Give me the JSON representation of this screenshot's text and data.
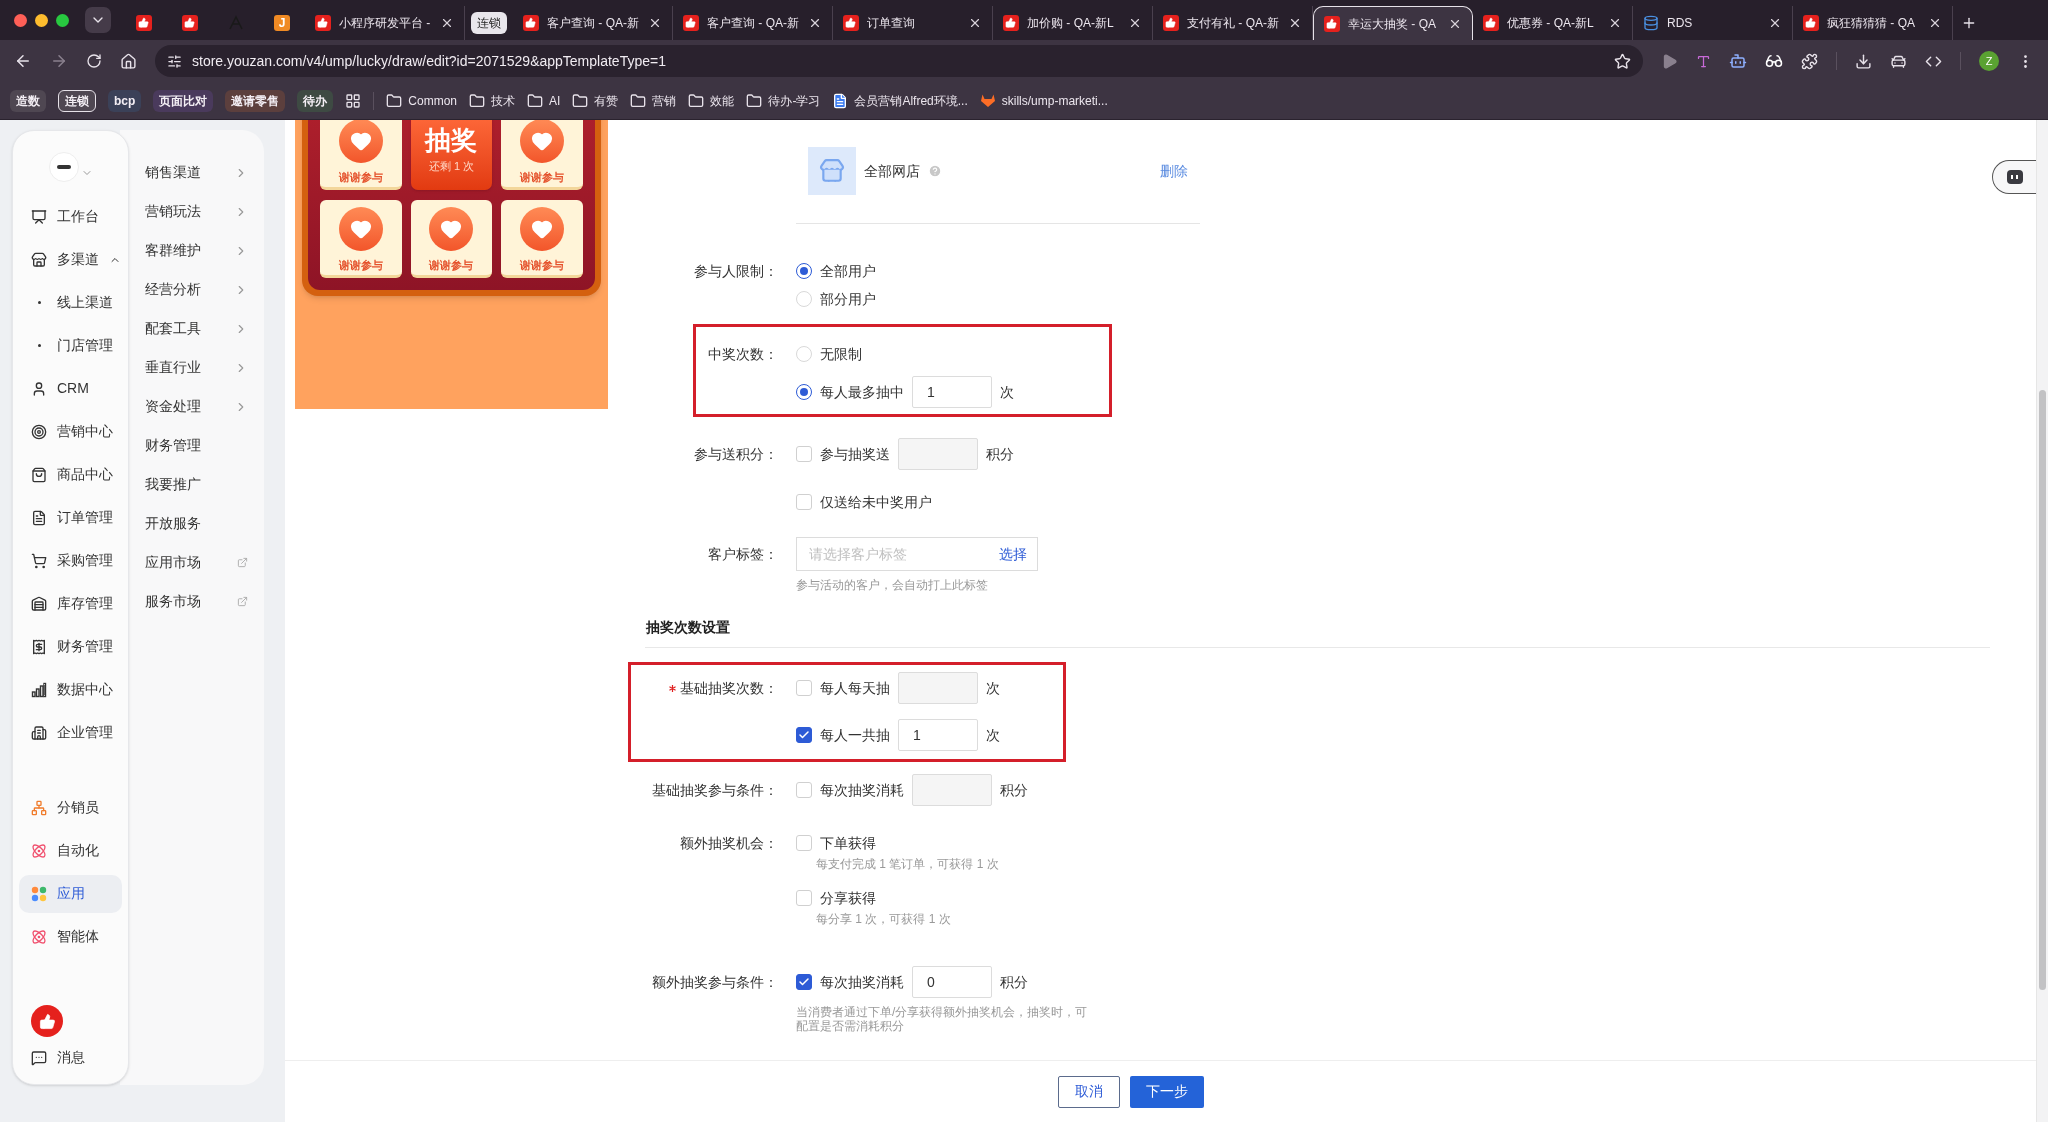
{
  "browser": {
    "tabs": [
      {
        "kind": "pinned",
        "selected": false
      },
      {
        "kind": "pinned",
        "selected": false
      },
      {
        "kind": "pinned",
        "selected": false
      },
      {
        "kind": "pinned",
        "glyph": "J",
        "selected": false
      },
      {
        "kind": "page",
        "label": "小程序研发平台 -",
        "selected": false
      },
      {
        "kind": "group",
        "label": "连锁",
        "selected": false
      },
      {
        "kind": "page",
        "label": "客户查询 - QA-新",
        "selected": false
      },
      {
        "kind": "page",
        "label": "客户查询 - QA-新",
        "selected": false
      },
      {
        "kind": "page",
        "label": "订单查询",
        "selected": false
      },
      {
        "kind": "page",
        "label": "加价购 - QA-新L",
        "selected": false
      },
      {
        "kind": "page",
        "label": "支付有礼 - QA-新",
        "selected": false
      },
      {
        "kind": "page",
        "label": "幸运大抽奖 - QA",
        "selected": true
      },
      {
        "kind": "page",
        "label": "优惠券 - QA-新L",
        "selected": false
      },
      {
        "kind": "page",
        "label": "RDS",
        "selected": false
      },
      {
        "kind": "page",
        "label": "疯狂猜猜猜 - QA",
        "selected": false
      }
    ],
    "address": "store.youzan.com/v4/ump/lucky/draw/edit?id=2071529&appTemplateType=1",
    "profile_initial": "Z",
    "bookmarks": [
      {
        "kind": "chip",
        "label": "造数",
        "color": "#4f4752",
        "outlined": false
      },
      {
        "kind": "chip",
        "label": "连锁",
        "color": "#4f4752",
        "outlined": true
      },
      {
        "kind": "chip",
        "label": "bcp",
        "color": "#3b4158",
        "outlined": false
      },
      {
        "kind": "chip",
        "label": "页面比对",
        "color": "#4a3a5c",
        "outlined": false
      },
      {
        "kind": "chip",
        "label": "邀请零售",
        "color": "#5c3f3d",
        "outlined": false
      },
      {
        "kind": "chip",
        "label": "待办",
        "color": "#3e4a43",
        "outlined": false
      },
      {
        "kind": "apps"
      },
      {
        "kind": "folder",
        "label": "Common"
      },
      {
        "kind": "folder",
        "label": "技术"
      },
      {
        "kind": "folder",
        "label": "AI"
      },
      {
        "kind": "folder",
        "label": "有赞"
      },
      {
        "kind": "folder",
        "label": "营销"
      },
      {
        "kind": "folder",
        "label": "效能"
      },
      {
        "kind": "folder",
        "label": "待办-学习"
      },
      {
        "kind": "doc",
        "label": "会员营销Alfred环境..."
      },
      {
        "kind": "gitlab",
        "label": "skills/ump-marketi..."
      }
    ]
  },
  "nav": {
    "main": [
      {
        "label": "工作台",
        "selected": false
      },
      {
        "label": "多渠道",
        "selected": false,
        "expanded": true,
        "children": [
          {
            "label": "线上渠道",
            "selected": false
          },
          {
            "label": "门店管理",
            "selected": false
          }
        ]
      },
      {
        "label": "CRM",
        "selected": false
      },
      {
        "label": "营销中心",
        "selected": false
      },
      {
        "label": "商品中心",
        "selected": false
      },
      {
        "label": "订单管理",
        "selected": false
      },
      {
        "label": "采购管理",
        "selected": false
      },
      {
        "label": "库存管理",
        "selected": false
      },
      {
        "label": "财务管理",
        "selected": false
      },
      {
        "label": "数据中心",
        "selected": false
      },
      {
        "label": "企业管理",
        "selected": false
      }
    ],
    "apps": [
      {
        "label": "分销员",
        "selected": false
      },
      {
        "label": "自动化",
        "selected": false
      },
      {
        "label": "应用",
        "selected": true
      },
      {
        "label": "智能体",
        "selected": false
      }
    ],
    "message": "消息"
  },
  "submenu": [
    {
      "label": "销售渠道",
      "kind": "submenu"
    },
    {
      "label": "营销玩法",
      "kind": "submenu"
    },
    {
      "label": "客群维护",
      "kind": "submenu"
    },
    {
      "label": "经营分析",
      "kind": "submenu"
    },
    {
      "label": "配套工具",
      "kind": "submenu"
    },
    {
      "label": "垂直行业",
      "kind": "submenu"
    },
    {
      "label": "资金处理",
      "kind": "submenu"
    },
    {
      "label": "财务管理",
      "kind": "plain"
    },
    {
      "label": "我要推广",
      "kind": "plain"
    },
    {
      "label": "开放服务",
      "kind": "plain"
    },
    {
      "label": "应用市场",
      "kind": "external"
    },
    {
      "label": "服务市场",
      "kind": "external"
    }
  ],
  "preview": {
    "cells": [
      {
        "kind": "prize",
        "label": "谢谢参与"
      },
      {
        "kind": "draw",
        "title": "抽奖",
        "note": "还剩 1 次"
      },
      {
        "kind": "prize",
        "label": "谢谢参与"
      },
      {
        "kind": "prize",
        "label": "谢谢参与"
      },
      {
        "kind": "prize",
        "label": "谢谢参与"
      },
      {
        "kind": "prize",
        "label": "谢谢参与"
      }
    ]
  },
  "form": {
    "store": {
      "name": "全部网店",
      "action": "删除"
    },
    "participant_limit": {
      "label": "参与人限制：",
      "options": [
        {
          "label": "全部用户",
          "selected": true
        },
        {
          "label": "部分用户",
          "selected": false
        }
      ]
    },
    "win_limit": {
      "label": "中奖次数：",
      "highlighted": true,
      "options": [
        {
          "label": "无限制",
          "selected": false
        },
        {
          "label": "每人最多抽中",
          "selected": true,
          "value": "1",
          "unit": "次"
        }
      ]
    },
    "points": {
      "label": "参与送积分：",
      "options": [
        {
          "label": "参与抽奖送",
          "checked": false,
          "unit": "积分"
        },
        {
          "label": "仅送给未中奖用户",
          "checked": false
        }
      ]
    },
    "customer_tag": {
      "label": "客户标签：",
      "placeholder": "请选择客户标签",
      "action": "选择",
      "help": "参与活动的客户，会自动打上此标签"
    },
    "section_title": "抽奖次数设置",
    "base_count": {
      "label": "基础抽奖次数：",
      "required": true,
      "highlighted": true,
      "options": [
        {
          "label": "每人每天抽",
          "checked": false,
          "unit": "次"
        },
        {
          "label": "每人一共抽",
          "checked": true,
          "value": "1",
          "unit": "次"
        }
      ]
    },
    "base_condition": {
      "label": "基础抽奖参与条件：",
      "options": [
        {
          "label": "每次抽奖消耗",
          "checked": false,
          "unit": "积分"
        }
      ]
    },
    "extra_chance": {
      "label": "额外抽奖机会：",
      "options": [
        {
          "label": "下单获得",
          "checked": false,
          "help": "每支付完成 1 笔订单，可获得 1 次"
        },
        {
          "label": "分享获得",
          "checked": false,
          "help": "每分享 1 次，可获得 1 次"
        }
      ]
    },
    "extra_condition": {
      "label": "额外抽奖参与条件：",
      "options": [
        {
          "label": "每次抽奖消耗",
          "checked": true,
          "value": "0",
          "unit": "积分"
        }
      ],
      "help": "当消费者通过下单/分享获得额外抽奖机会，抽奖时，可配置是否需消耗积分"
    }
  },
  "footer": {
    "buttons": [
      {
        "label": "取消",
        "kind": "secondary"
      },
      {
        "label": "下一步",
        "kind": "primary"
      }
    ]
  }
}
